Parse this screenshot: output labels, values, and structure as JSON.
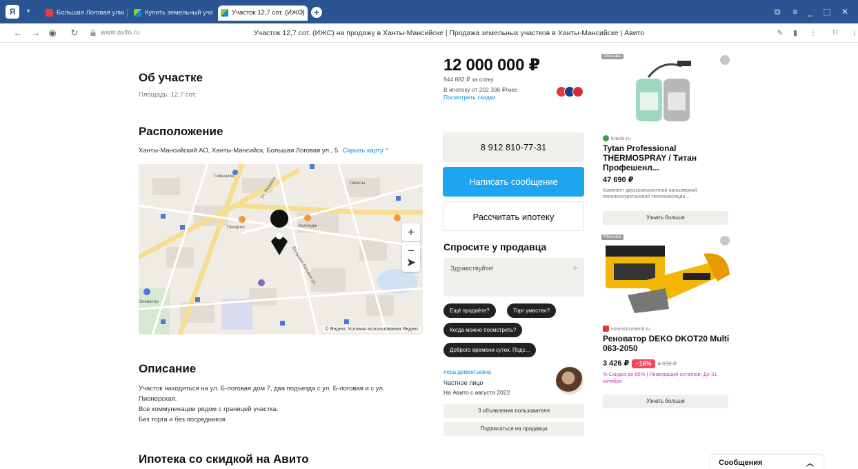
{
  "browser": {
    "tabs": [
      {
        "label": "Большая Логовая улица..."
      },
      {
        "label": "Купить земельный участ..."
      },
      {
        "label": "Участок 12,7 сот. (ИЖС)"
      }
    ],
    "url_domain": "www.avito.ru",
    "page_title": "Участок 12,7 сот. (ИЖС) на продажу в Ханты-Мансийске | Продажа земельных участков в Ханты-Мансийске | Авито"
  },
  "about": {
    "title": "Об участке",
    "area": "Площадь: 12.7 сот."
  },
  "location": {
    "title": "Расположение",
    "address": "Ханты-Мансийский АО, Ханты-Мансийск, Большая Логовая ул., 5",
    "hide_map": "Скрыть карту ^",
    "map_footer": "© Яндекс Условия использования Яндекс",
    "map_labels": [
      "Ул. Рознина",
      "Большая Логовая ул.",
      "Пикеты",
      "Гимназия",
      "Колледж",
      "Пекарня",
      "Элеватор"
    ]
  },
  "description": {
    "title": "Описание",
    "lines": [
      "Участок находиться на ул. Б-логовая дом 7, два подъезда с ул. Б-логовая и с ул.",
      "Пионерская.",
      "Все коммуникации рядом с границей участка.",
      "Без торга и без посредников"
    ]
  },
  "mortgage_section_title": "Ипотека со скидкой на Авито",
  "listing": {
    "price": "12 000 000 ₽",
    "per_sotka": "944 882 ₽ за сотку",
    "mortgage_line": "В ипотеку от 202 336 ₽/мес",
    "mortgage_link": "Посмотреть скидки",
    "phone": "8 912 810-77-31",
    "write_button": "Написать сообщение",
    "calc_button": "Рассчитать ипотеку"
  },
  "ask": {
    "title": "Спросите у продавца",
    "placeholder": "Здравствуйте!",
    "chips": [
      "Ещё продаёте?",
      "Торг уместен?",
      "Когда можно посмотреть?",
      "Доброго времени суток. Подс..."
    ]
  },
  "seller": {
    "name": "лера дементьевна",
    "type": "Частное лицо",
    "since": "На Авито с августа 2022",
    "ads_button": "3 объявления пользователя",
    "subscribe_button": "Подписаться на продавца"
  },
  "ads": [
    {
      "tag": "Реклама",
      "source": "kravki.ru",
      "title": "Tytan Professional THERMOSPRAY / Титан Профешенл...",
      "price": "47 690 ₽",
      "desc": "Комплект двухкомпонентной напыляемой пенополиуретановой теплоизоляции...",
      "button": "Узнать больше"
    },
    {
      "tag": "Реклама",
      "source": "vseinstrumenti.ru",
      "title": "Реноватор DEKO DKOT20 Multi 063-2050",
      "price": "3 426 ₽",
      "discount": "−16%",
      "old_price": "4 098 ₽",
      "sale": "% Скидка до 85% | Ликвидация остатков! До 31 октября",
      "button": "Узнать больше"
    }
  ],
  "messages_widget": "Сообщения",
  "colors": {
    "accent_blue": "#1ea4f0",
    "link_blue": "#0a8ddc",
    "chrome_blue": "#2a5592",
    "discount_red": "#f3475b"
  }
}
